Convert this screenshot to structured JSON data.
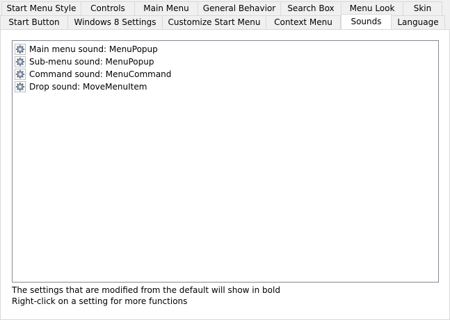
{
  "tabs": {
    "row1": [
      "Start Menu Style",
      "Controls",
      "Main Menu",
      "General Behavior",
      "Search Box",
      "Menu Look",
      "Skin"
    ],
    "row2": [
      "Start Button",
      "Windows 8 Settings",
      "Customize Start Menu",
      "Context Menu",
      "Sounds",
      "Language"
    ],
    "selected": "Sounds"
  },
  "settings": [
    {
      "label": "Main menu sound: MenuPopup",
      "icon": "gear-icon"
    },
    {
      "label": "Sub-menu sound: MenuPopup",
      "icon": "gear-icon"
    },
    {
      "label": "Command sound: MenuCommand",
      "icon": "gear-icon"
    },
    {
      "label": "Drop sound: MoveMenuItem",
      "icon": "gear-icon"
    }
  ],
  "footer": {
    "line1": "The settings that are modified from the default will show in bold",
    "line2": "Right-click on a setting for more functions"
  }
}
